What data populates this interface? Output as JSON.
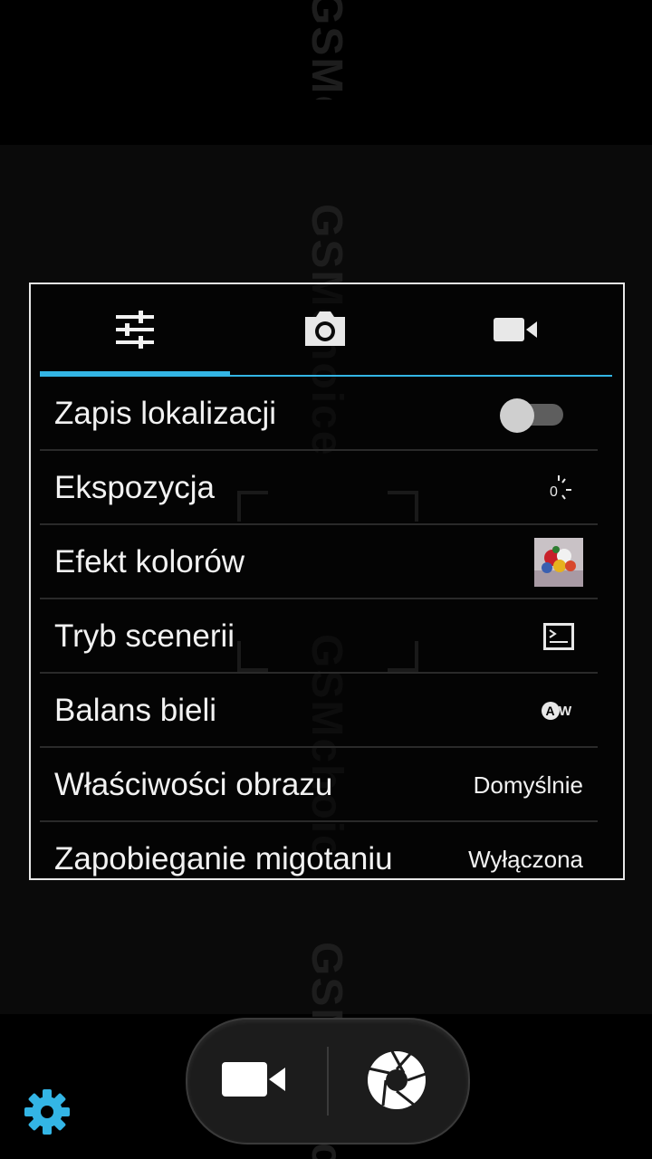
{
  "watermark": {
    "text": "GSMchoice"
  },
  "tabs": [
    {
      "name": "general-settings",
      "icon": "sliders-icon",
      "active": true
    },
    {
      "name": "photo-settings",
      "icon": "camera-icon",
      "active": false
    },
    {
      "name": "video-settings",
      "icon": "video-camera-icon",
      "active": false
    }
  ],
  "settings": {
    "location": {
      "label": "Zapis lokalizacji",
      "enabled": false
    },
    "exposure": {
      "label": "Ekspozycja",
      "icon": "exposure-icon",
      "icon_text": "0"
    },
    "color_effect": {
      "label": "Efekt kolorów",
      "icon": "color-effect-thumbnail"
    },
    "scene_mode": {
      "label": "Tryb scenerii",
      "icon": "scene-mode-icon"
    },
    "white_balance": {
      "label": "Balans bieli",
      "icon": "white-balance-auto-icon",
      "icon_text": "AW"
    },
    "image_properties": {
      "label": "Właściwości obrazu",
      "value": "Domyślnie"
    },
    "anti_flicker": {
      "label": "Zapobieganie migotaniu",
      "value": "Wyłączona"
    }
  },
  "controls": {
    "video_button_icon": "video-camera-icon",
    "shutter_button_icon": "shutter-icon",
    "settings_icon": "gear-icon"
  },
  "colors": {
    "accent": "#33b5e5",
    "gear": "#33b5e5"
  }
}
